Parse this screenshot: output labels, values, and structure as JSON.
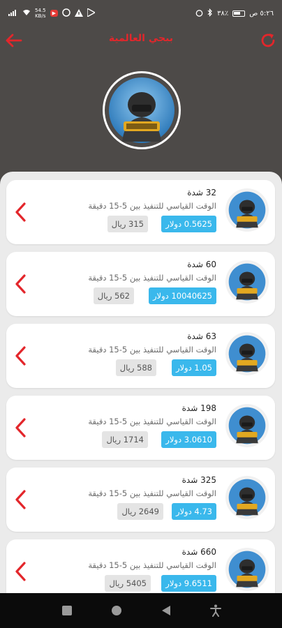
{
  "status_bar": {
    "time": "٥:٢٦ ص",
    "battery": "٣٨٪",
    "net_speed_value": "54.5",
    "net_speed_unit": "KB/s",
    "youtube_badge": "▶"
  },
  "header": {
    "title": "ببجي العالمية",
    "back_icon": "arrow-left-icon",
    "refresh_icon": "refresh-icon",
    "accent_color": "#e3262b"
  },
  "products": [
    {
      "title": "32 شدة",
      "desc": "الوقت القياسي للتنفيذ بين 5-15 دقيقة",
      "usd": "0.5625 دولار",
      "sar": "315 ريال"
    },
    {
      "title": "60 شدة",
      "desc": "الوقت القياسي للتنفيذ بين 5-15 دقيقة",
      "usd": "10040625 دولار",
      "sar": "562 ريال"
    },
    {
      "title": "63 شدة",
      "desc": "الوقت القياسي للتنفيذ بين 5-15 دقيقة",
      "usd": "1.05 دولار",
      "sar": "588 ريال"
    },
    {
      "title": "198 شدة",
      "desc": "الوقت القياسي للتنفيذ بين 5-15 دقيقة",
      "usd": "3.0610 دولار",
      "sar": "1714 ريال"
    },
    {
      "title": "325 شدة",
      "desc": "الوقت القياسي للتنفيذ بين 5-15 دقيقة",
      "usd": "4.73 دولار",
      "sar": "2649 ريال"
    },
    {
      "title": "660 شدة",
      "desc": "الوقت القياسي للتنفيذ بين 5-15 دقيقة",
      "usd": "9.6511 دولار",
      "sar": "5405 ريال"
    }
  ],
  "colors": {
    "header_bg": "#4d4a48",
    "price_usd_bg": "#3ab8ec",
    "price_sar_bg": "#e4e4e4",
    "chevron": "#e3262b"
  },
  "nav": {
    "recents_icon": "square-icon",
    "home_icon": "circle-icon",
    "back_icon": "triangle-back-icon",
    "accessibility_icon": "accessibility-icon"
  }
}
